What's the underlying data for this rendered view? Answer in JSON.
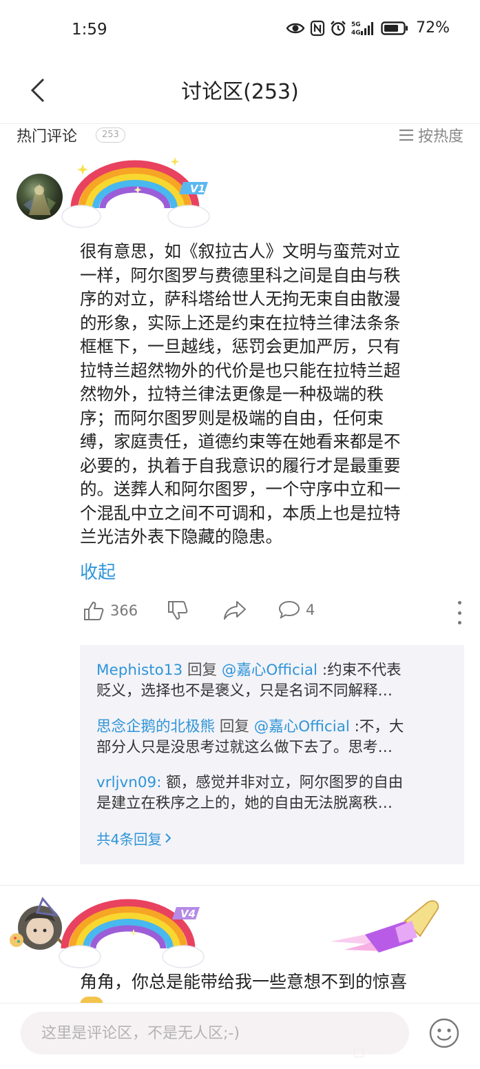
{
  "status_bar": {
    "time": "1:59",
    "battery_percent": "72%",
    "icons": [
      "eye-icon",
      "nfc-icon",
      "alarm-icon",
      "signal-5g-icon",
      "battery-icon"
    ],
    "signal_label_top": "5G",
    "signal_label_bottom": "4G"
  },
  "header": {
    "title": "讨论区(253)",
    "back_icon": "chevron-left-icon"
  },
  "section": {
    "title": "热门评论",
    "count": "253",
    "sort_label": "按热度",
    "sort_icon": "list-icon"
  },
  "comment1": {
    "level_badge": "V1",
    "text": "很有意思，如《叙拉古人》文明与蛮荒对立\n一样，阿尔图罗与费德里科之间是自由与秩\n序的对立，萨科塔给世人无拘无束自由散漫\n的形象，实际上还是约束在拉特兰律法条条\n框框下，一旦越线，惩罚会更加严厉，只有\n拉特兰超然物外的代价是也只能在拉特兰超\n然物外，拉特兰律法更像是一种极端的秩\n序；而阿尔图罗则是极端的自由，任何束\n缚，家庭责任，道德约束等在她看来都是不\n必要的，执着于自我意识的履行才是最重要\n的。送葬人和阿尔图罗，一个守序中立和一\n个混乱中立之间不可调和，本质上也是拉特\n兰光洁外表下隐藏的隐患。",
    "collapse_label": "收起",
    "like_count": "366",
    "reply_count": "4",
    "replies": [
      {
        "author": "Mephisto13",
        "verb": " 回复 ",
        "target": "@嘉心Official",
        "line1": " :约束不代表",
        "line2": "贬义，选择也不是褒义，只是名词不同解释…"
      },
      {
        "author": "思念企鹅的北极熊",
        "verb": " 回复 ",
        "target": "@嘉心Official",
        "line1": " :不，大",
        "line2": "部分人只是没思考过就这么做下去了。思考…"
      },
      {
        "author": "vrljvn09:",
        "verb": "",
        "target": "",
        "line1": " 额，感觉并非对立，阿尔图罗的自由",
        "line2": "是建立在秩序之上的，她的自由无法脱离秩…"
      }
    ],
    "all_replies_label": "共4条回复",
    "colors": {
      "link": "#2f95d8",
      "reply_bg": "#f3f3f8"
    }
  },
  "comment2": {
    "level_badge": "V4",
    "text": "角角，你总是能带给我一些意想不到的惊喜"
  },
  "bottom_bar": {
    "input_placeholder": "这里是评论区，不是无人区;-)",
    "emoji_icon": "smiley-icon"
  }
}
